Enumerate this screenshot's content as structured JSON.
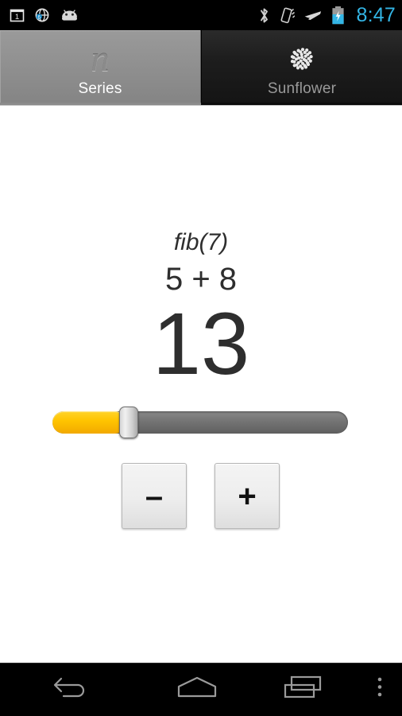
{
  "status_bar": {
    "left_icons": [
      {
        "name": "sim-card-1-icon",
        "label": "1"
      },
      {
        "name": "browser-globe-icon",
        "label": "browser"
      },
      {
        "name": "android-robot-icon",
        "label": "android"
      }
    ],
    "right_icons": [
      {
        "name": "bluetooth-icon",
        "label": "bluetooth"
      },
      {
        "name": "vibrate-mode-icon",
        "label": "vibrate"
      },
      {
        "name": "airplane-mode-icon",
        "label": "airplane"
      },
      {
        "name": "battery-charging-icon",
        "label": "battery charging"
      }
    ],
    "clock": "8:47",
    "clock_color": "#33b5e5",
    "background_color": "#000000"
  },
  "tabs": {
    "items": [
      {
        "label": "Series",
        "icon": "series-n-icon",
        "icon_glyph": "n",
        "selected": true
      },
      {
        "label": "Sunflower",
        "icon": "sunflower-dots-icon",
        "selected": false
      }
    ],
    "selected_index": 0,
    "selected_bg": "#8e8e8e",
    "unselected_bg": "#141414"
  },
  "main": {
    "expression_label": "fib(7)",
    "expression_sum": "5 + 8",
    "result_value": "13",
    "text_color": "#2e2e2e",
    "background_color": "#ffffff"
  },
  "slider": {
    "name": "term-index-slider",
    "percent": 25,
    "fill_color": "#ffc400",
    "track_color": "#747474",
    "thumb_color": "#e0e0e0"
  },
  "stepper": {
    "decrement_label": "–",
    "increment_label": "+",
    "button_bg": "#ededed"
  },
  "nav_bar": {
    "items": [
      {
        "name": "back-button",
        "label": "Back"
      },
      {
        "name": "home-button",
        "label": "Home"
      },
      {
        "name": "recent-apps-button",
        "label": "Recent apps"
      },
      {
        "name": "overflow-menu-button",
        "label": "Menu"
      }
    ],
    "background_color": "#000000",
    "icon_color": "#9a9a9a"
  }
}
